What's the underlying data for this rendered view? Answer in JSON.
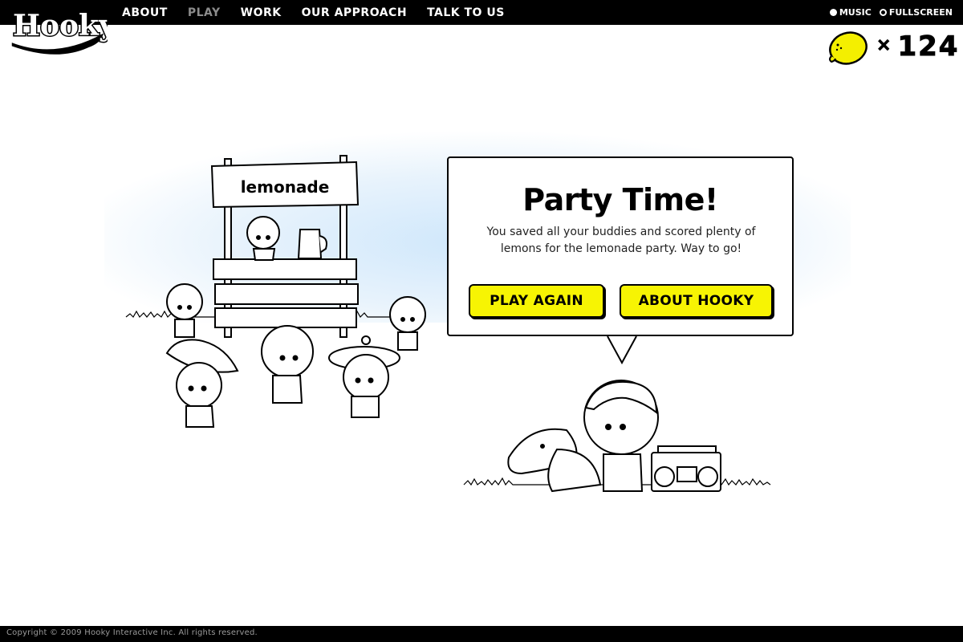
{
  "brand": {
    "logo_text": "Hooky"
  },
  "nav": {
    "items": [
      {
        "label": "ABOUT",
        "active": false
      },
      {
        "label": "PLAY",
        "active": true
      },
      {
        "label": "WORK",
        "active": false
      },
      {
        "label": "OUR APPROACH",
        "active": false
      },
      {
        "label": "TALK TO US",
        "active": false
      }
    ]
  },
  "toggles": {
    "music": {
      "label": "MUSIC",
      "on": true
    },
    "fullscreen": {
      "label": "FULLSCREEN",
      "on": false
    }
  },
  "lemon_counter": {
    "prefix": "×",
    "count": "124",
    "icon": "lemon-icon",
    "lemon_color": "#f4ef00"
  },
  "scene": {
    "stand_sign": "lemonade",
    "sky_color": "#cfe7fb"
  },
  "dialog": {
    "title": "Party Time!",
    "message": "You saved all your buddies and scored plenty of lemons for the lemonade party. Way to go!",
    "play_again_label": "PLAY AGAIN",
    "about_label": "ABOUT HOOKY",
    "button_color": "#f7f403"
  },
  "footer": {
    "copyright": "Copyright © 2009 Hooky Interactive Inc. All rights reserved."
  }
}
